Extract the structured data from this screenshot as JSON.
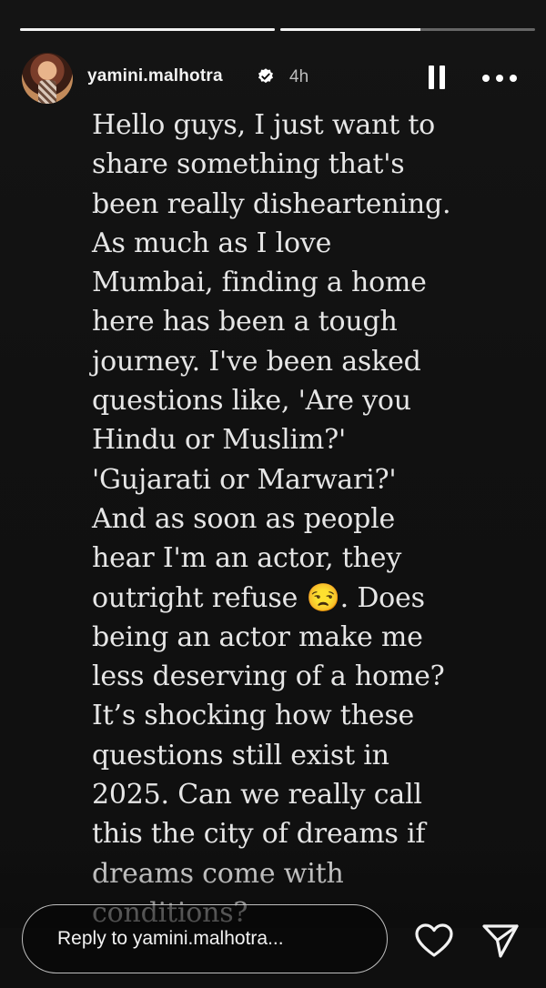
{
  "story": {
    "username": "yamini.malhotra",
    "timestamp": "4h",
    "verified": true,
    "progress_segments": [
      1.0,
      0.55
    ],
    "text_lines": [
      "Hello guys, I just want to",
      "share something that's",
      "been really disheartening.",
      "As much as I love",
      "Mumbai, finding a home",
      "here has been a tough",
      "journey. I've been asked",
      "questions like, 'Are you",
      "Hindu or Muslim?'",
      "'Gujarati or Marwari?'",
      "And as soon as people",
      "hear I'm an actor, they",
      "outright refuse 😒. Does",
      "being an actor make me",
      "less deserving of a home?",
      "It’s shocking how these",
      "questions still exist in",
      "2025. Can we really call",
      "this the city of dreams if",
      "dreams come with",
      "conditions?"
    ]
  },
  "reply": {
    "placeholder": "Reply to yamini.malhotra..."
  },
  "icons": {
    "pause": "pause-icon",
    "more": "more-horizontal-icon",
    "like": "heart-icon",
    "send": "send-icon",
    "verified": "verified-badge-icon"
  },
  "colors": {
    "background": "#0b0b0b",
    "text": "#e6e6e6",
    "verified": "#ffffff"
  }
}
